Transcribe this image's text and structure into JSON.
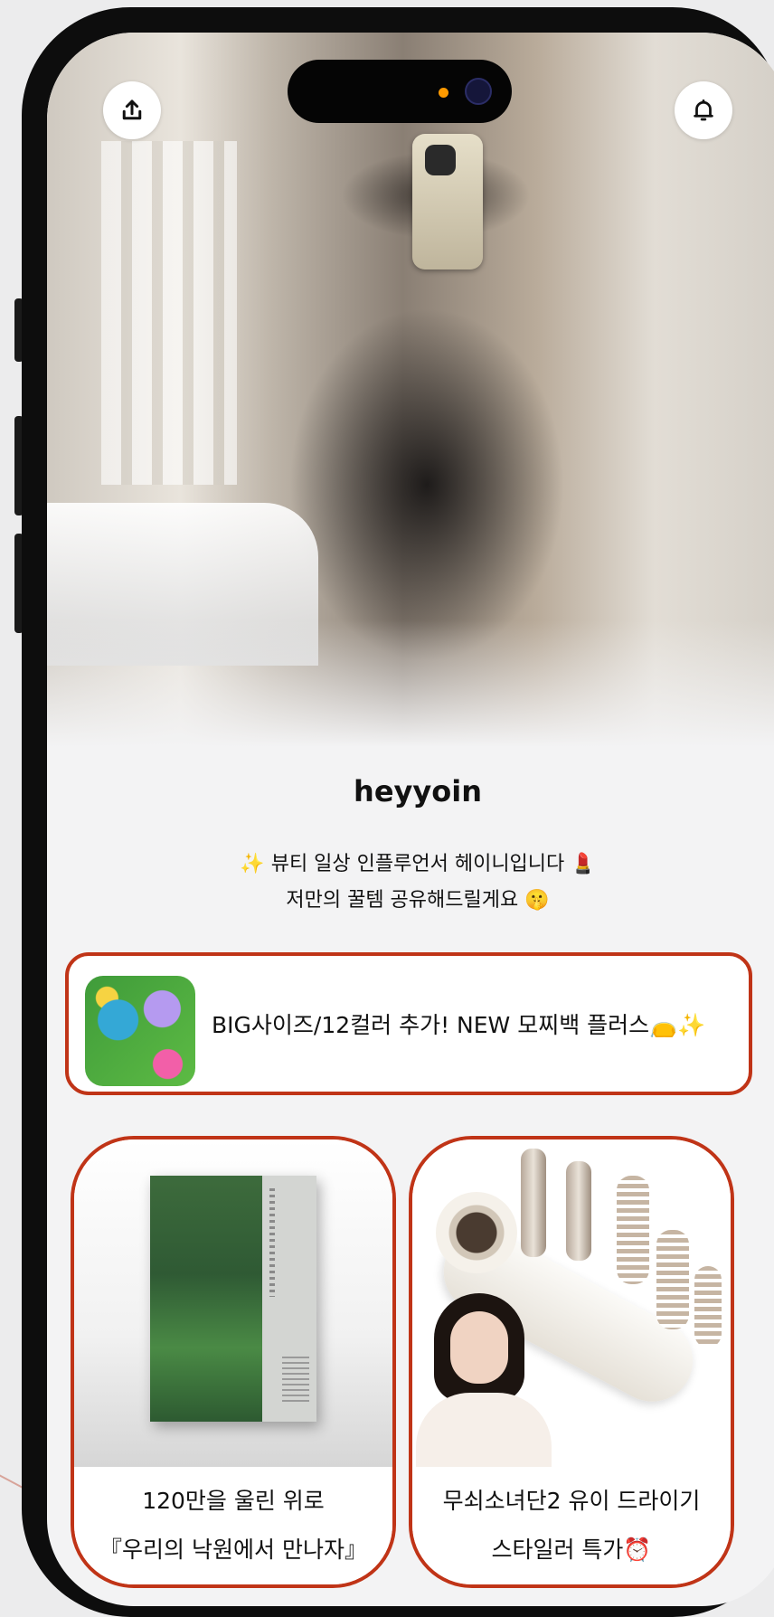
{
  "header": {
    "share_icon": "share-upload-icon",
    "notification_icon": "bell-icon"
  },
  "profile": {
    "name": "heyyoin",
    "bio_line1": "✨ 뷰티 일상 인플루언서 헤이니입니다 💄",
    "bio_line2": "저만의 꿀템 공유해드릴게요 🤫"
  },
  "featured_link": {
    "title": "BIG사이즈/12컬러 추가! NEW 모찌백 플러스👝✨"
  },
  "products": [
    {
      "line1": "120만을 울린 위로",
      "line2": "『우리의 낙원에서 만나자』"
    },
    {
      "line1": "무쇠소녀단2 유이 드라이기",
      "line2": "스타일러 특가⏰"
    }
  ],
  "colors": {
    "accent_border": "#c03417",
    "background": "#f3f3f4",
    "frame": "#0d0d0d"
  }
}
